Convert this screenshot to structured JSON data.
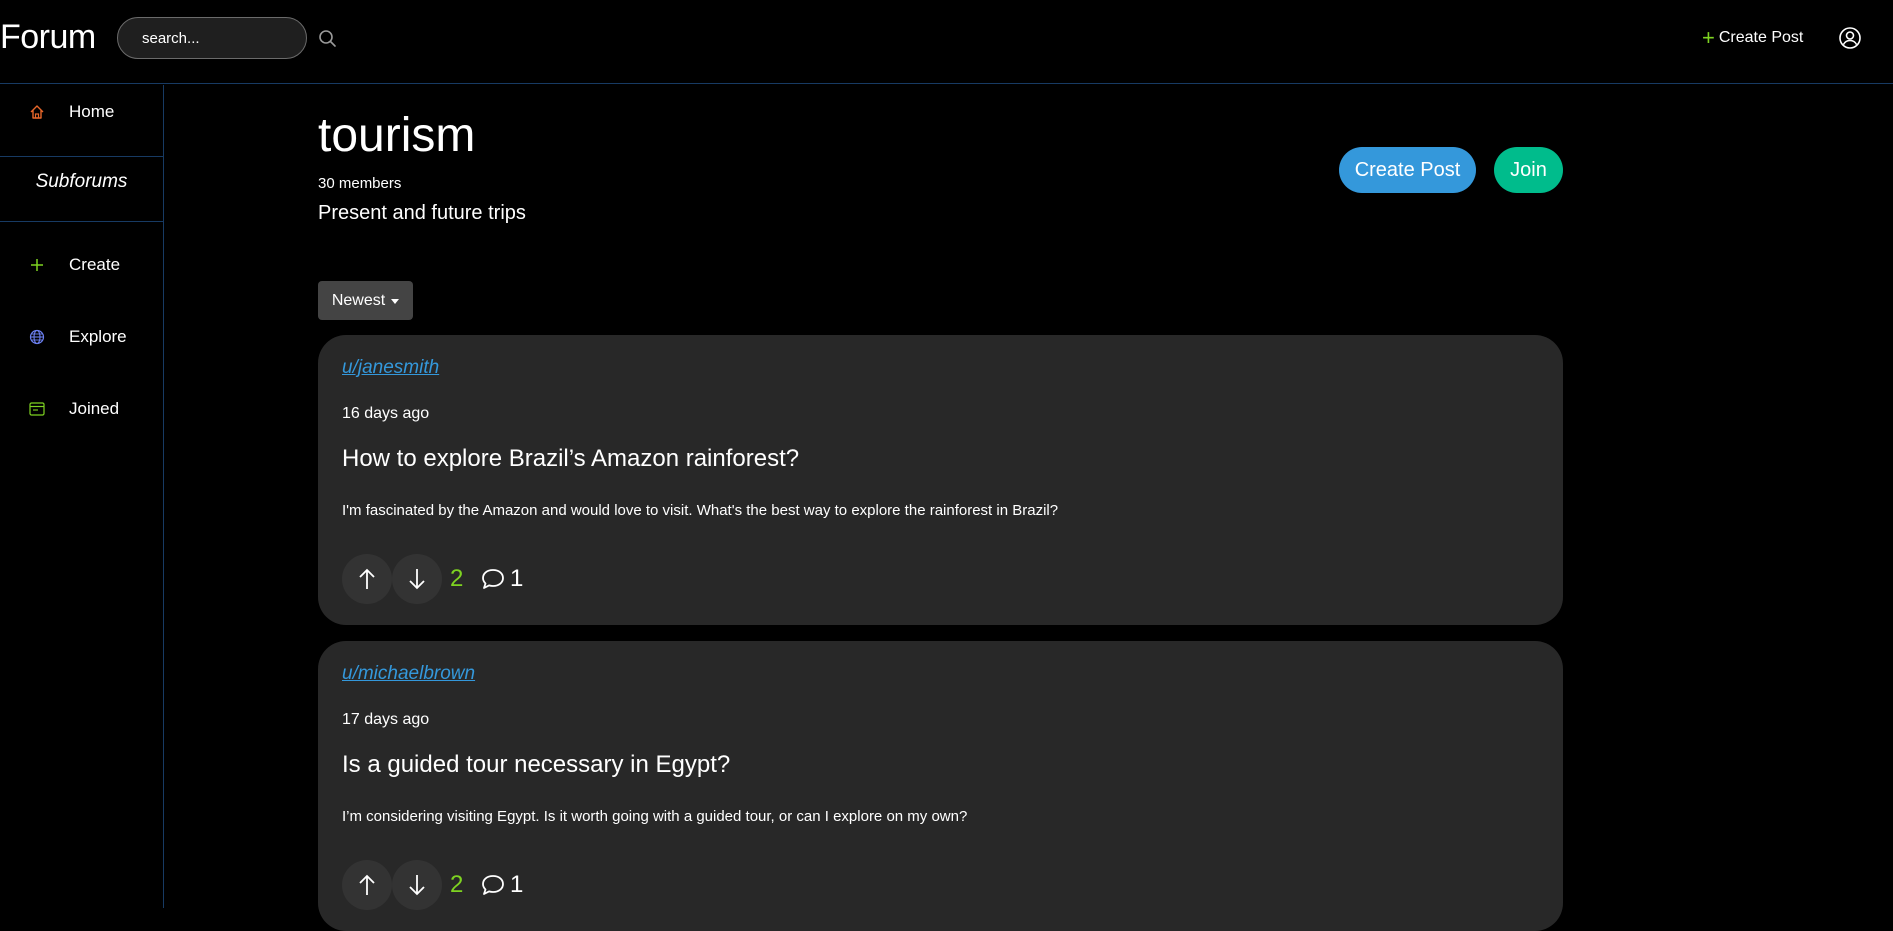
{
  "navbar": {
    "brand": "Forum",
    "search_placeholder": "search...",
    "create_post_label": "Create Post"
  },
  "sidebar": {
    "home_label": "Home",
    "subforums_title": "Subforums",
    "items": [
      {
        "label": "Create",
        "icon": "plus-icon"
      },
      {
        "label": "Explore",
        "icon": "globe-icon"
      },
      {
        "label": "Joined",
        "icon": "card-icon"
      }
    ]
  },
  "subforum": {
    "name": "tourism",
    "members": "30 members",
    "description": "Present and future trips",
    "create_post_button": "Create Post",
    "join_button": "Join",
    "sort_label": "Newest"
  },
  "posts": [
    {
      "author": "u/janesmith",
      "time": "16 days ago",
      "title": "How to explore Brazil’s Amazon rainforest?",
      "body": "I'm fascinated by the Amazon and would love to visit. What's the best way to explore the rainforest in Brazil?",
      "score": "2",
      "comments": "1"
    },
    {
      "author": "u/michaelbrown",
      "time": "17 days ago",
      "title": "Is a guided tour necessary in Egypt?",
      "body": "I’m considering visiting Egypt. Is it worth going with a guided tour, or can I explore on my own?",
      "score": "2",
      "comments": "1"
    }
  ],
  "colors": {
    "accent_blue": "#3498db",
    "accent_green": "#00bc8c",
    "score_green": "#7ed321",
    "home_icon_orange": "#e8672a",
    "card_bg": "#282828"
  }
}
